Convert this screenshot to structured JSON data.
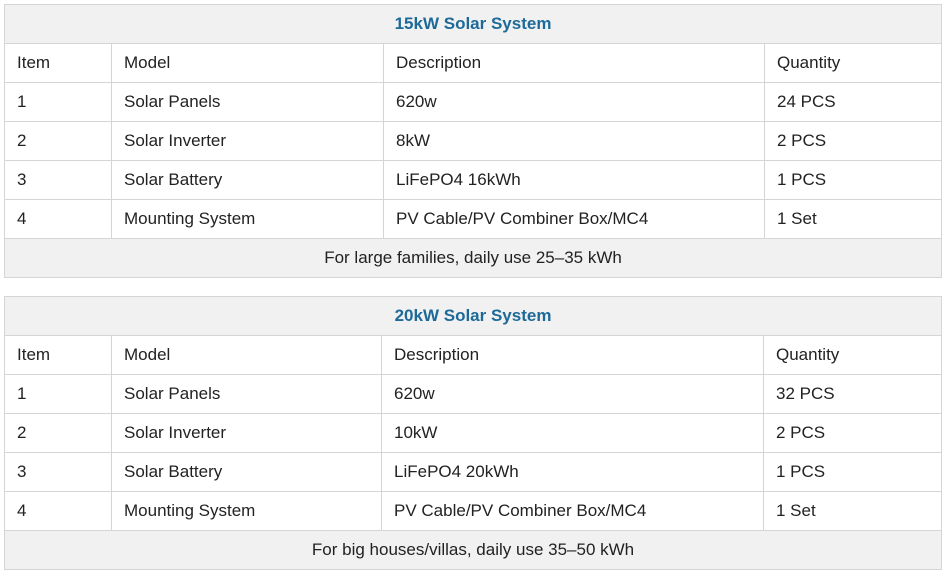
{
  "tables": [
    {
      "title": "15kW Solar System",
      "headers": [
        "Item",
        "Model",
        "Description",
        "Quantity"
      ],
      "rows": [
        [
          "1",
          "Solar Panels",
          "620w",
          "24 PCS"
        ],
        [
          "2",
          "Solar Inverter",
          "8kW",
          "2 PCS"
        ],
        [
          "3",
          "Solar Battery",
          "LiFePO4 16kWh",
          "1 PCS"
        ],
        [
          "4",
          "Mounting System",
          "PV Cable/PV Combiner Box/MC4",
          "1 Set"
        ]
      ],
      "footer": "For large families, daily use 25–35 kWh"
    },
    {
      "title": "20kW Solar System",
      "headers": [
        "Item",
        "Model",
        "Description",
        "Quantity"
      ],
      "rows": [
        [
          "1",
          "Solar Panels",
          "620w",
          "32 PCS"
        ],
        [
          "2",
          "Solar Inverter",
          "10kW",
          "2 PCS"
        ],
        [
          "3",
          "Solar Battery",
          "LiFePO4 20kWh",
          "1 PCS"
        ],
        [
          "4",
          "Mounting System",
          "PV Cable/PV Combiner Box/MC4",
          "1 Set"
        ]
      ],
      "footer": "For big houses/villas, daily use 35–50 kWh"
    }
  ],
  "colors": {
    "title_text": "#1d6a99",
    "band_background": "#f1f1f1",
    "border": "#d5d5d5"
  }
}
